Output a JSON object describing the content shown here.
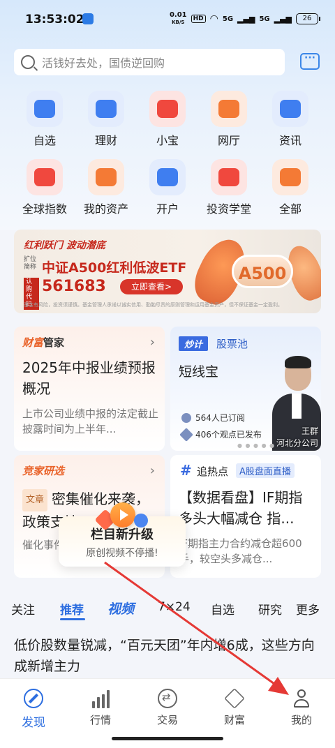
{
  "status_bar": {
    "time": "13:53:02",
    "speed": "0.01",
    "speed_unit": "KB/S",
    "hd": "HD",
    "signal1": "5G",
    "signal2": "5G",
    "battery": "26"
  },
  "search": {
    "placeholder": "活钱好去处，国债逆回购"
  },
  "quick_grid": [
    {
      "label": "自选",
      "icon": "chart-up-icon",
      "color": "#3f7ef0"
    },
    {
      "label": "理财",
      "icon": "money-bag-icon",
      "color": "#3f7ef0"
    },
    {
      "label": "小宝",
      "icon": "robot-icon",
      "color": "#f0483e"
    },
    {
      "label": "网厅",
      "icon": "house-icon",
      "color": "#f47a35"
    },
    {
      "label": "资讯",
      "icon": "news-icon",
      "color": "#3f7ef0"
    },
    {
      "label": "全球指数",
      "icon": "monitor-chart-icon",
      "color": "#f0483e"
    },
    {
      "label": "我的资产",
      "icon": "pie-chart-icon",
      "color": "#f47a35"
    },
    {
      "label": "开户",
      "icon": "id-card-icon",
      "color": "#3f7ef0"
    },
    {
      "label": "投资学堂",
      "icon": "graduation-cap-icon",
      "color": "#f0483e"
    },
    {
      "label": "全部",
      "icon": "grid-icon",
      "color": "#f47a35"
    }
  ],
  "banner": {
    "tagline": "红利跃门 波动潜底",
    "expand_label": "扩位简称",
    "fund_name": "中证A500红利低波ETF",
    "code_label": "认购代码",
    "code": "561683",
    "button": "立即查看>",
    "badge": "A500",
    "fine_print": "基金有风险，投资须谨慎。基金管理人承诺以诚实信用、勤勉尽责的原则管理和运用基金资产，但不保证基金一定盈利。"
  },
  "cards": {
    "wealth": {
      "brand_a": "财富",
      "brand_b": "管家",
      "title": "2025年中报业绩预报概况",
      "desc": "上市公司业绩中报的法定截止披露时间为上半年..."
    },
    "picks": {
      "brand_a": "竞家",
      "brand_b": "研选",
      "tag": "文章",
      "title": "密集催化来袭，政策支持",
      "desc": "催化事件...板块情绪..."
    },
    "stock_pool": {
      "pill": "炒计",
      "pool": "股票池",
      "title": "短线宝",
      "subscribers": "564人已订阅",
      "views": "406个观点已发布",
      "analyst": "王群",
      "branch": "河北分公司"
    },
    "hot": {
      "hash": "#",
      "label": "追热点",
      "badge": "A股盘面直播",
      "title": "【数据看盘】IF期指多头大幅减仓 指...",
      "desc": "IF期指主力合约减仓超600手，较空头多减仓..."
    }
  },
  "popup": {
    "title": "栏目新升级",
    "subtitle": "原创视频不停播!"
  },
  "tabs": [
    "关注",
    "推荐",
    "视频",
    "7×24",
    "自选",
    "研究",
    "更多"
  ],
  "active_tab": "推荐",
  "news": {
    "headline": "低价股数量锐减，“百元天团”年内增6成，这些方向成新增主力"
  },
  "bottom_nav": [
    {
      "label": "发现",
      "icon": "compass-icon",
      "active": true
    },
    {
      "label": "行情",
      "icon": "bar-chart-icon",
      "active": false
    },
    {
      "label": "交易",
      "icon": "exchange-icon",
      "active": false
    },
    {
      "label": "财富",
      "icon": "diamond-icon",
      "active": false
    },
    {
      "label": "我的",
      "icon": "user-icon",
      "active": false
    }
  ],
  "colors": {
    "accent": "#2d6ee0",
    "arrow": "#e53935"
  }
}
